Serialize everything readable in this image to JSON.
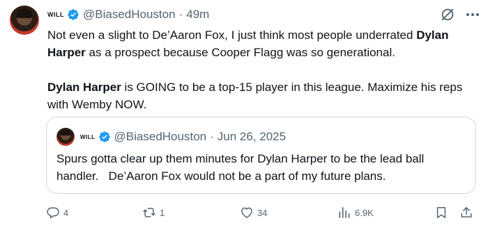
{
  "tweet": {
    "author_name": "WILL",
    "handle": "@BiasedHouston",
    "separator": "·",
    "time": "49m",
    "paragraph1": {
      "part1": "Not even a slight to De’Aaron Fox, I just think most people underrated ",
      "bold": "Dylan Harper",
      "part2": " as a prospect because Cooper Flagg was so generational."
    },
    "paragraph2": {
      "bold": "Dylan Harper",
      "part2": " is GOING to be a top-15 player in this league. Maximize his reps with Wemby NOW."
    }
  },
  "quote": {
    "author_name": "WILL",
    "handle": "@BiasedHouston",
    "separator": "·",
    "date": "Jun 26, 2025",
    "text": "Spurs gotta clear up them minutes for Dylan Harper to be the lead ball handler.   De’Aaron Fox would not be a part of my future plans."
  },
  "actions": {
    "replies": "4",
    "reposts": "1",
    "likes": "34",
    "views": "6.9K"
  },
  "icons": {
    "verified": "verified-badge-icon",
    "grok": "grok-icon",
    "more": "more-icon",
    "reply": "reply-icon",
    "repost": "repost-icon",
    "like": "heart-icon",
    "views": "views-icon",
    "bookmark": "bookmark-icon",
    "share": "share-icon"
  },
  "colors": {
    "verified_blue": "#1d9bf0",
    "muted_text": "#536471",
    "main_text": "#0f1419",
    "border": "#cfd9de"
  }
}
